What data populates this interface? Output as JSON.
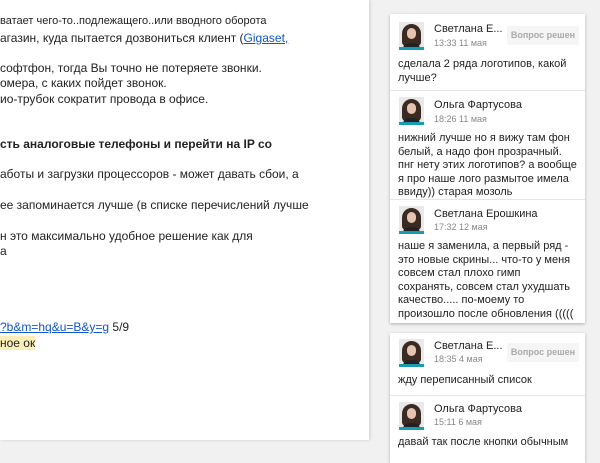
{
  "document": {
    "lines": [
      "ватает чего-то..подлежащего..или вводного оборота",
      "агазин, куда пытается дозвониться клиент (",
      "софтфон, тогда Вы точно не потеряете звонки.",
      "омера, с каких пойдет звонок.",
      "ио-трубок сократит провода в офисе.",
      "сть аналоговые телефоны и перейти на IP со",
      "аботы и загрузки процессоров - может давать сбои, а",
      "ее запоминается лучше (в списке перечислений лучше",
      "н это максимально удобное решение как для",
      "а"
    ],
    "link_gigaset": "Gigaset,",
    "url_text": "?b&m=hq&u=B&y=g",
    "page_count": " 5/9",
    "highlight_text": "ное ок"
  },
  "threads": [
    {
      "comments": [
        {
          "author": "Светлана Е...",
          "time": "13:33 11 мая",
          "resolve": "Вопрос решен",
          "text": "сделала 2 ряда логотипов, какой лучше?"
        },
        {
          "author": "Ольга Фартусова",
          "time": "18:26 11 мая",
          "text": "нижний лучше но я вижу там фон белый, а надо фон прозрачный. пнг нету этих логотипов? а вообще я про наше лого размытое имела ввиду)) старая мозоль"
        },
        {
          "author": "Светлана Ерошкина",
          "time": "17:32 12 мая",
          "text": "наше я заменила, а первый ряд - это новые скрины... что-то у меня совсем стал плохо гимп сохранять, совсем стал ухудшать качество..... по-моему то произошло после обновления ((((("
        }
      ]
    },
    {
      "comments": [
        {
          "author": "Светлана Е...",
          "time": "18:35 4 мая",
          "resolve": "Вопрос решен",
          "text": "жду переписанный список"
        },
        {
          "author": "Ольга Фартусова",
          "time": "15:11 6 мая",
          "text": "давай так после кнопки обычным"
        }
      ]
    }
  ]
}
